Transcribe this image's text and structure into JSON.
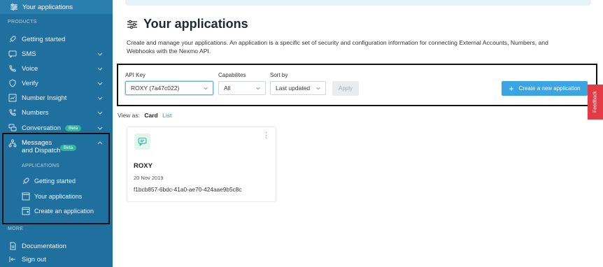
{
  "sidebar": {
    "top_item": {
      "label": "Your applications",
      "icon": "sliders-icon"
    },
    "products_heading": "PRODUCTS",
    "items": [
      {
        "label": "Getting started",
        "icon": "rocket-icon"
      },
      {
        "label": "SMS",
        "icon": "chat-icon"
      },
      {
        "label": "Voice",
        "icon": "phone-icon"
      },
      {
        "label": "Verify",
        "icon": "shield-icon"
      },
      {
        "label": "Number Insight",
        "icon": "insight-icon"
      },
      {
        "label": "Numbers",
        "icon": "numbers-icon"
      },
      {
        "label": "Conversation",
        "icon": "conversation-icon",
        "badge": "Beta"
      }
    ],
    "messages": {
      "label": "Messages and Dispatch",
      "badge": "Beta",
      "applications_heading": "APPLICATIONS",
      "sub_items": [
        {
          "label": "Getting started",
          "icon": "rocket-icon"
        },
        {
          "label": "Your applications",
          "icon": "window-icon"
        },
        {
          "label": "Create an application",
          "icon": "create-window-icon"
        }
      ]
    },
    "more_heading": "MORE",
    "bottom_items": [
      {
        "label": "Documentation",
        "icon": "document-icon"
      },
      {
        "label": "Sign out",
        "icon": "signout-icon"
      }
    ]
  },
  "page": {
    "title": "Your applications",
    "description": "Create and manage your applications. An application is a specific set of security and configuration information for connecting External Accounts, Numbers, and Webhooks with the Nexmo API."
  },
  "filters": {
    "api_key_label": "API Key",
    "api_key_value": "ROXY (7a47c022)",
    "capabilities_label": "Capabilites",
    "capabilities_value": "All",
    "sort_label": "Sort by",
    "sort_value": "Last updated",
    "apply_label": "Apply",
    "create_label": "Create a new application",
    "feedback_label": "Feedback"
  },
  "view": {
    "label": "View as:",
    "card": "Card",
    "list": "List"
  },
  "applications": [
    {
      "name": "ROXY",
      "date": "20 Nov 2019",
      "id": "f1bcb857-6bdc-41a0-ae70-424aae9b5c8c"
    }
  ],
  "colors": {
    "sidebar": "#1f6f9f",
    "primary": "#3ba5e3",
    "beta": "#2fb59b",
    "feedback": "#e23b46"
  }
}
